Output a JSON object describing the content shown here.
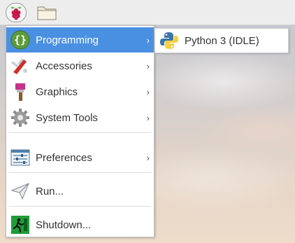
{
  "taskbar": {
    "menu_icon": "raspberry-pi-icon",
    "files_icon": "folder-icon"
  },
  "menu": {
    "items": [
      {
        "label": "Programming",
        "icon": "programming-icon",
        "has_submenu": true,
        "active": true
      },
      {
        "label": "Accessories",
        "icon": "accessories-icon",
        "has_submenu": true
      },
      {
        "label": "Graphics",
        "icon": "graphics-icon",
        "has_submenu": true
      },
      {
        "label": "System Tools",
        "icon": "system-tools-icon",
        "has_submenu": true
      },
      {
        "label": "Preferences",
        "icon": "preferences-icon",
        "has_submenu": true
      },
      {
        "label": "Run...",
        "icon": "run-icon",
        "has_submenu": false
      },
      {
        "label": "Shutdown...",
        "icon": "shutdown-icon",
        "has_submenu": false
      }
    ],
    "arrow": "›"
  },
  "submenu": {
    "items": [
      {
        "label": "Python 3 (IDLE)",
        "icon": "python-icon"
      }
    ]
  },
  "colors": {
    "active": "#4a90e2",
    "raspberry": "#c51a4a",
    "python_blue": "#3b77a8",
    "python_yellow": "#f5cf3f"
  }
}
